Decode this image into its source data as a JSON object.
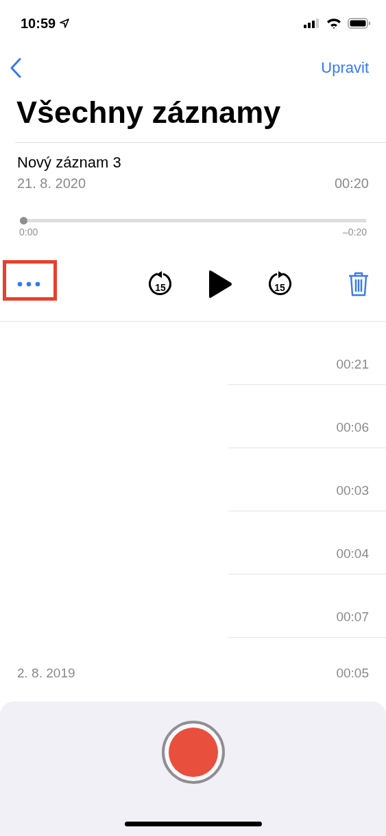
{
  "status_bar": {
    "time": "10:59"
  },
  "nav": {
    "edit": "Upravit"
  },
  "title": "Všechny záznamy",
  "current": {
    "name": "Nový záznam 3",
    "date": "21. 8. 2020",
    "duration": "00:20",
    "elapsed": "0:00",
    "remaining": "–0:20",
    "level": 0,
    "more_highlighted": true,
    "skip_back_label": "15",
    "skip_forward_label": "15"
  },
  "recordings": [
    {
      "duration": "00:21"
    },
    {
      "duration": "00:06"
    },
    {
      "duration": "00:03"
    },
    {
      "duration": "00:04"
    },
    {
      "duration": "00:07"
    },
    {
      "date": "2. 8. 2019",
      "duration": "00:05"
    }
  ]
}
